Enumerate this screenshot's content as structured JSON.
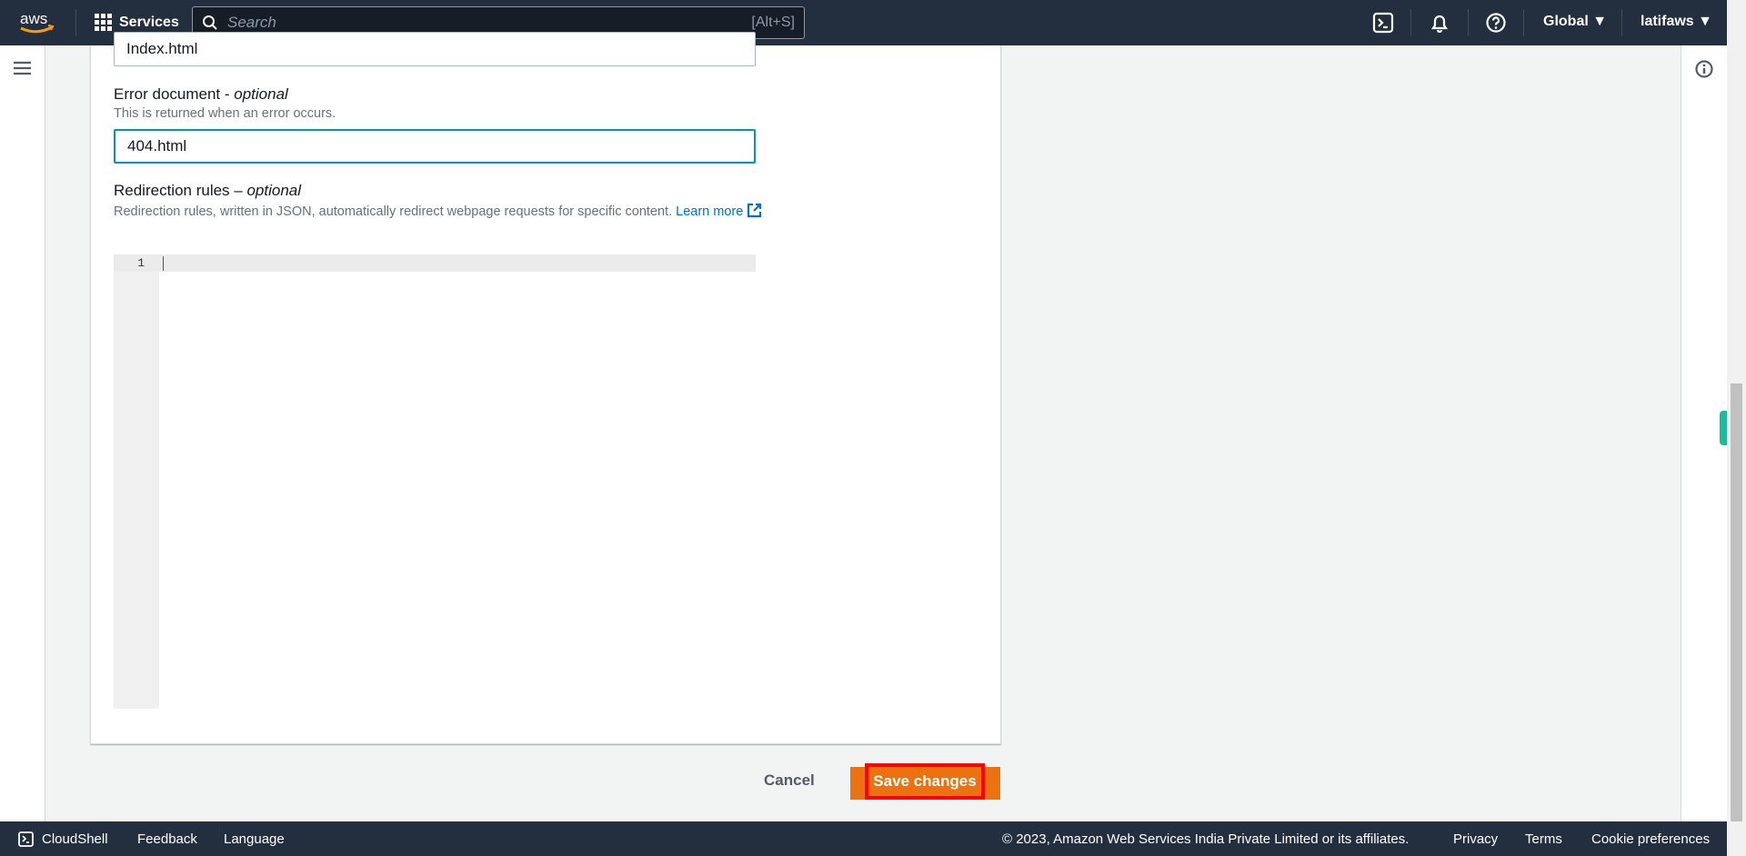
{
  "topbar": {
    "logo": "aws",
    "services": "Services",
    "search_placeholder": "Search",
    "search_shortcut": "[Alt+S]",
    "region": "Global",
    "user": "latifaws"
  },
  "form": {
    "index_value": "Index.html",
    "error_label": "Error document - ",
    "error_optional": "optional",
    "error_hint": "This is returned when an error occurs.",
    "error_value": "404.html",
    "redir_label": "Redirection rules – ",
    "redir_optional": "optional",
    "redir_hint": "Redirection rules, written in JSON, automatically redirect webpage requests for specific content.",
    "learn_more": "Learn more",
    "line_number": "1"
  },
  "actions": {
    "cancel": "Cancel",
    "save": "Save changes"
  },
  "footer": {
    "cloudshell": "CloudShell",
    "feedback": "Feedback",
    "language": "Language",
    "copyright": "© 2023, Amazon Web Services India Private Limited or its affiliates.",
    "privacy": "Privacy",
    "terms": "Terms",
    "cookies": "Cookie preferences"
  },
  "colors": {
    "nav": "#232f3e",
    "primary": "#ec7211",
    "highlight": "#ff0000",
    "link": "#0073bb"
  }
}
